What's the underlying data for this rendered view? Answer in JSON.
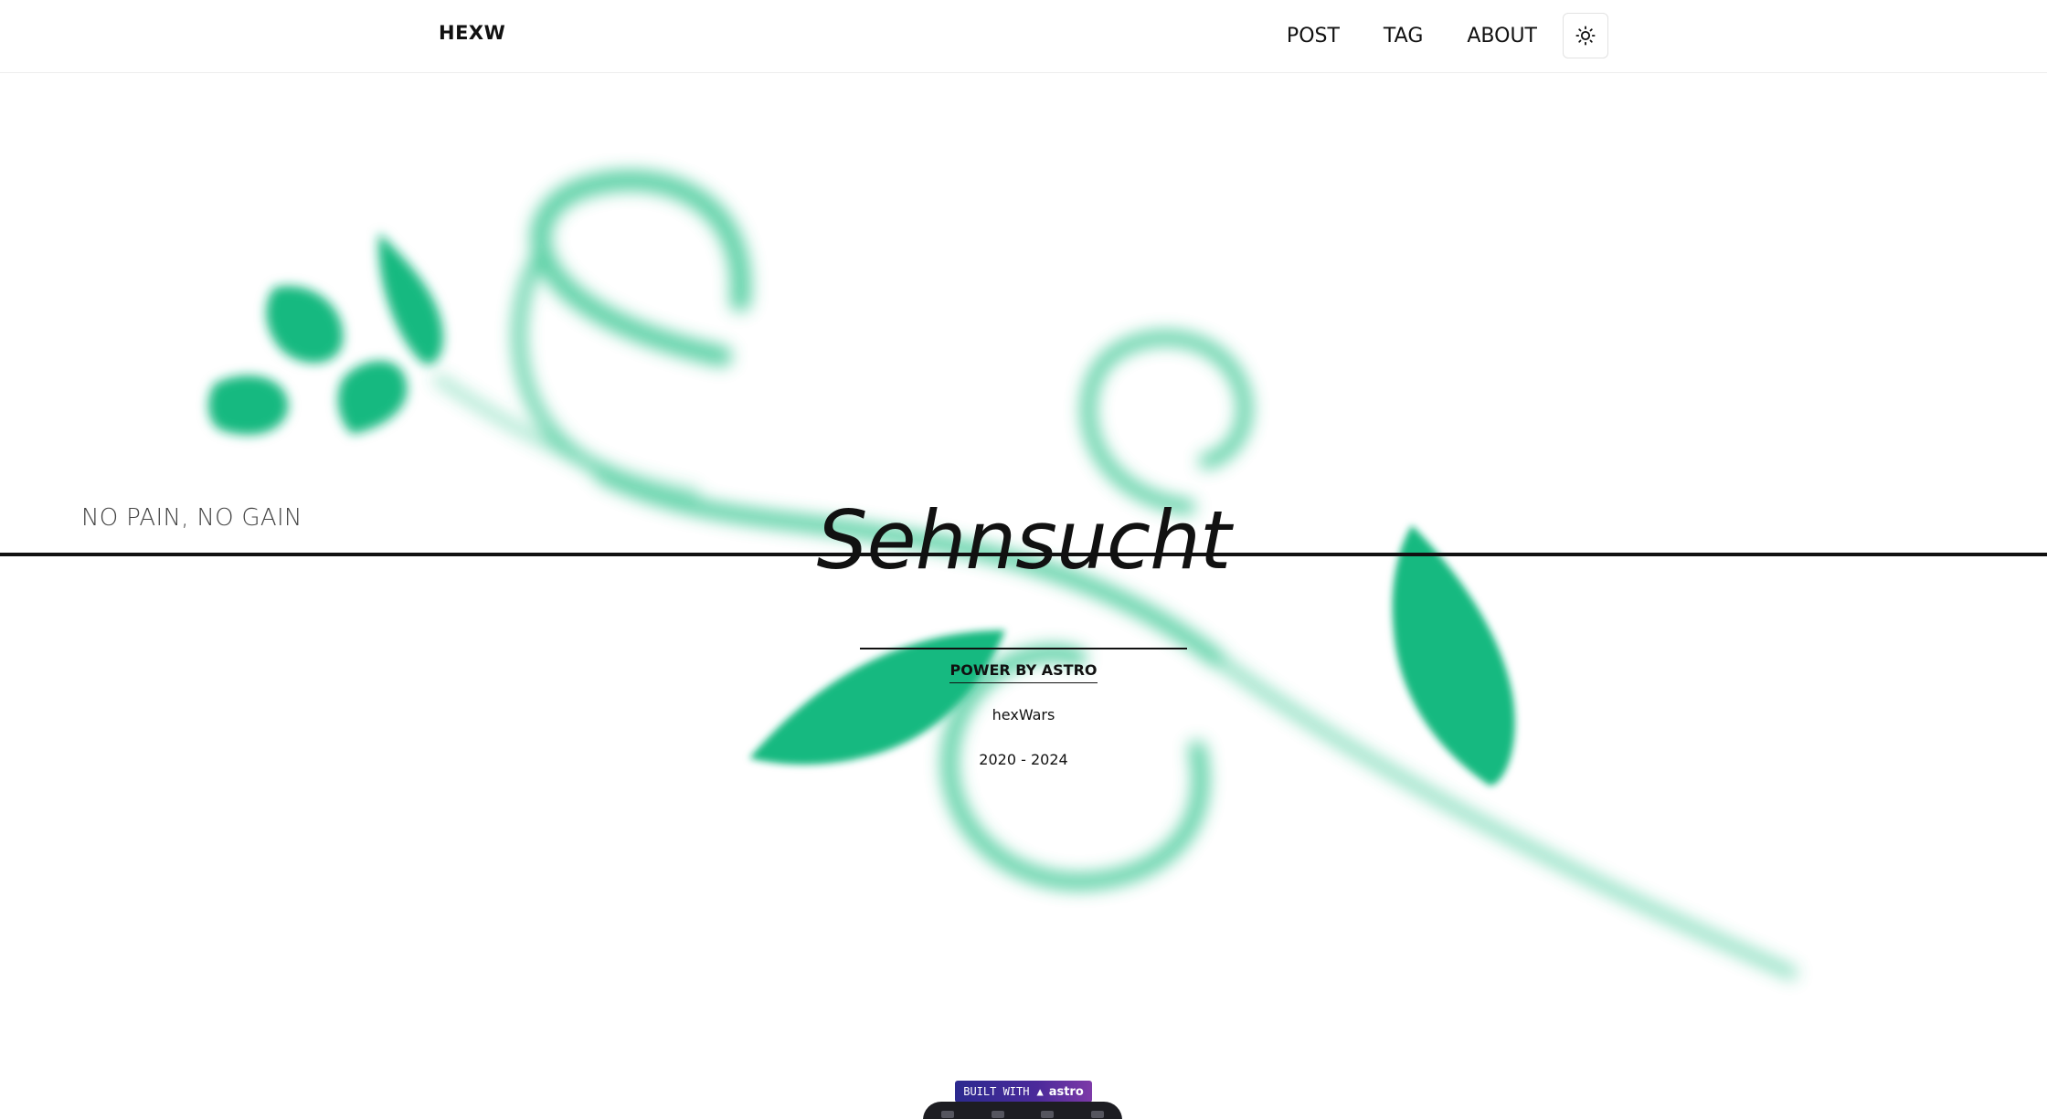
{
  "header": {
    "brand": "HEXW",
    "nav": [
      {
        "label": "POST"
      },
      {
        "label": "TAG"
      },
      {
        "label": "ABOUT"
      }
    ],
    "theme_toggle_icon": "sun-icon"
  },
  "hero": {
    "motto": "NO PAIN, NO GAIN",
    "title": "Sehnsucht",
    "power_link": "POWER BY ASTRO",
    "author": "hexWars",
    "years": "2020 - 2024"
  },
  "badge": {
    "built_with": "BUILT WITH",
    "astro": "astro"
  },
  "colors": {
    "leaf_green": "#12b980",
    "text": "#111111",
    "badge_start": "#2c2a8f",
    "badge_end": "#7d3aa8",
    "toolbar": "#1d1d22"
  }
}
